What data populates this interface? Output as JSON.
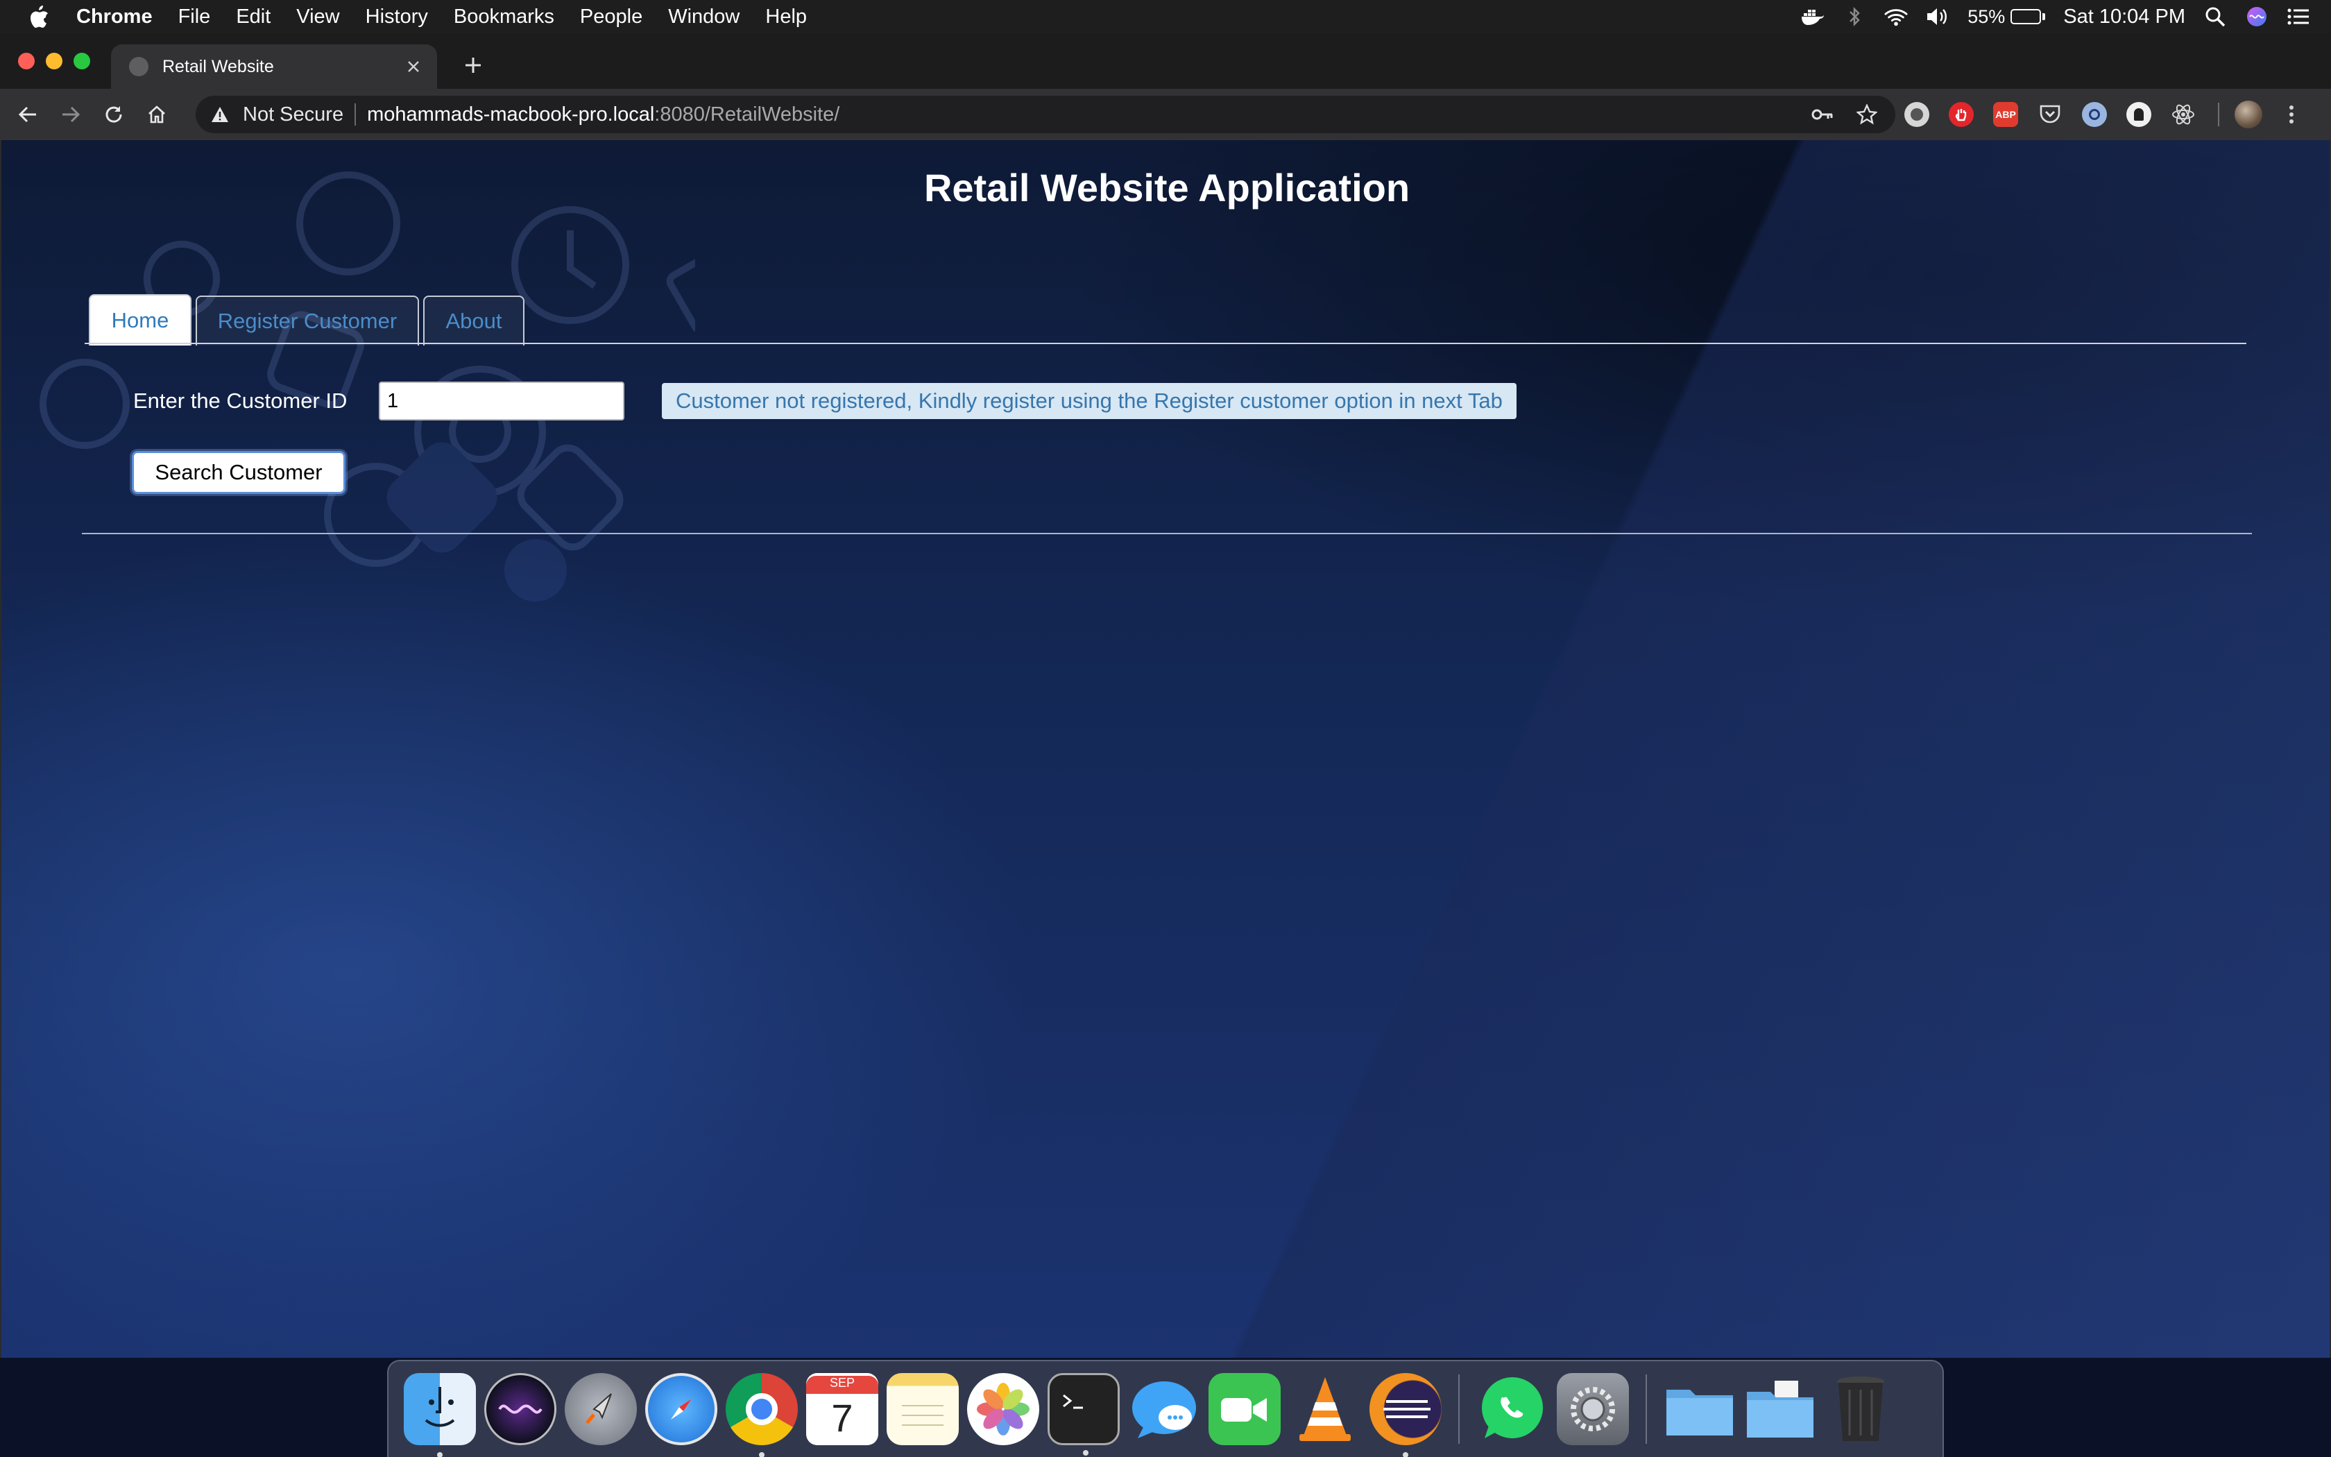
{
  "menubar": {
    "app_name": "Chrome",
    "menus": [
      "File",
      "Edit",
      "View",
      "History",
      "Bookmarks",
      "People",
      "Window",
      "Help"
    ],
    "battery_percent": "55%",
    "battery_level": 0.55,
    "clock": "Sat 10:04 PM",
    "status_icons": [
      "docker-icon",
      "bluetooth-icon",
      "wifi-icon",
      "volume-icon",
      "battery-icon",
      "spotlight-icon",
      "siri-icon",
      "notification-center-icon"
    ]
  },
  "browser": {
    "tab_title": "Retail Website",
    "security_label": "Not Secure",
    "url_host": "mohammads-macbook-pro.local",
    "url_path": ":8080/RetailWebsite/",
    "extensions": [
      "extension-icon",
      "adblock-stop-icon",
      "abp-icon",
      "pocket-icon",
      "extension-icon",
      "extension-icon",
      "react-devtools-icon"
    ],
    "abp_label": "ABP"
  },
  "app": {
    "title": "Retail Website Application",
    "tabs": [
      {
        "label": "Home",
        "active": true
      },
      {
        "label": "Register Customer",
        "active": false
      },
      {
        "label": "About",
        "active": false
      }
    ],
    "customer_id_label": "Enter the Customer ID",
    "customer_id_value": "1",
    "message": "Customer not registered, Kindly register using the Register customer option in next Tab",
    "search_button": "Search Customer"
  },
  "dock": {
    "apps": [
      "finder",
      "siri",
      "launchpad",
      "safari",
      "chrome",
      "calendar",
      "notes",
      "photos",
      "terminal",
      "messages",
      "facetime",
      "vlc",
      "eclipse",
      "whatsapp",
      "system-preferences",
      "folder",
      "documents-folder",
      "trash"
    ],
    "calendar_month": "SEP",
    "calendar_day": "7"
  },
  "colors": {
    "accent": "#2f7bbd",
    "message_bg": "#d7e7f4",
    "message_text": "#3676ad"
  }
}
